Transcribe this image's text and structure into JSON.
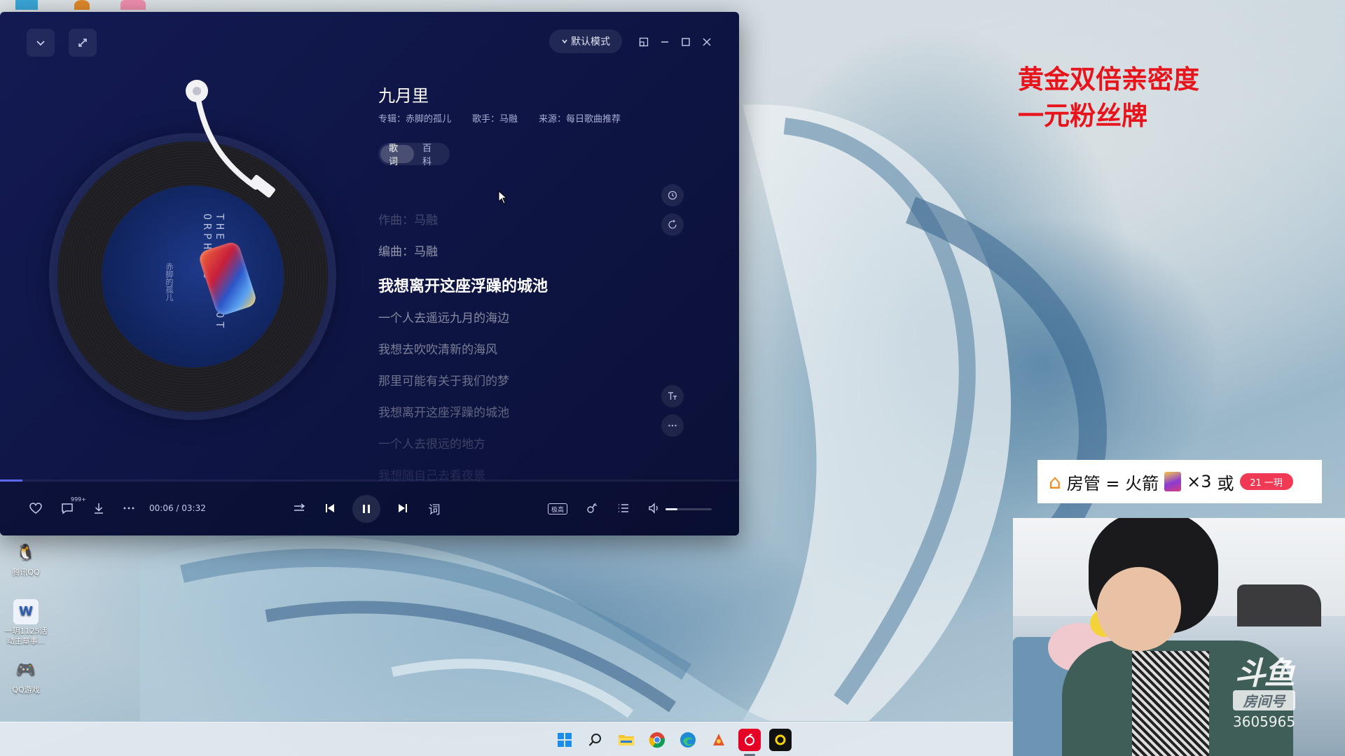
{
  "player": {
    "mode_label": "默认模式",
    "song": {
      "title": "九月里",
      "album": "专辑：赤脚的孤儿",
      "artist": "歌手：马融",
      "source": "来源：每日歌曲推荐"
    },
    "tabs": [
      {
        "label": "歌词",
        "active": true
      },
      {
        "label": "百科",
        "active": false
      }
    ],
    "lyrics": [
      {
        "text": "作曲：马融",
        "state": "past-far"
      },
      {
        "text": "编曲：马融",
        "state": "past"
      },
      {
        "text": "我想离开这座浮躁的城池",
        "state": "current"
      },
      {
        "text": "一个人去遥远九月的海边",
        "state": "next"
      },
      {
        "text": "我想去吹吹清新的海风",
        "state": "next"
      },
      {
        "text": "那里可能有关于我们的梦",
        "state": "next"
      },
      {
        "text": "我想离开这座浮躁的城池",
        "state": "next"
      },
      {
        "text": "一个人去很远的地方",
        "state": "fade"
      },
      {
        "text": "我想随自己去看夜景",
        "state": "fade-more"
      }
    ],
    "album_art": {
      "vertical_text": "THE BAREFOOT ORPHANS",
      "vertical_text_cn": "赤脚的孤儿"
    },
    "playback": {
      "time": "00:06 / 03:32",
      "comment_count_badge": "999+",
      "lyrics_toggle_label": "词",
      "quality_badge": "极高",
      "progress": 0.03,
      "volume": 0.25
    },
    "colors": {
      "accent": "#5b6cf2",
      "bg_start": "#131a52",
      "bg_end": "#0b1037"
    }
  },
  "desktop": {
    "icons": [
      {
        "name": "qq",
        "label": "腾讯QQ",
        "glyph": "🐧"
      },
      {
        "name": "doc",
        "label": "一玥1125活动主章事...",
        "glyph": "W"
      },
      {
        "name": "qqgame",
        "label": "QQ游戏",
        "glyph": "🎮"
      }
    ]
  },
  "overlay": {
    "promo_lines": [
      "黄金双倍亲密度",
      "一元粉丝牌"
    ],
    "promo_color": "#e8141c",
    "rule": {
      "text_1": "房管 = 火箭",
      "multiplier": "×3",
      "or": "或",
      "fan_badge": "21 一玥"
    },
    "watermark": {
      "logo": "斗鱼",
      "sub": "房间号",
      "room_number": "3605965"
    }
  }
}
